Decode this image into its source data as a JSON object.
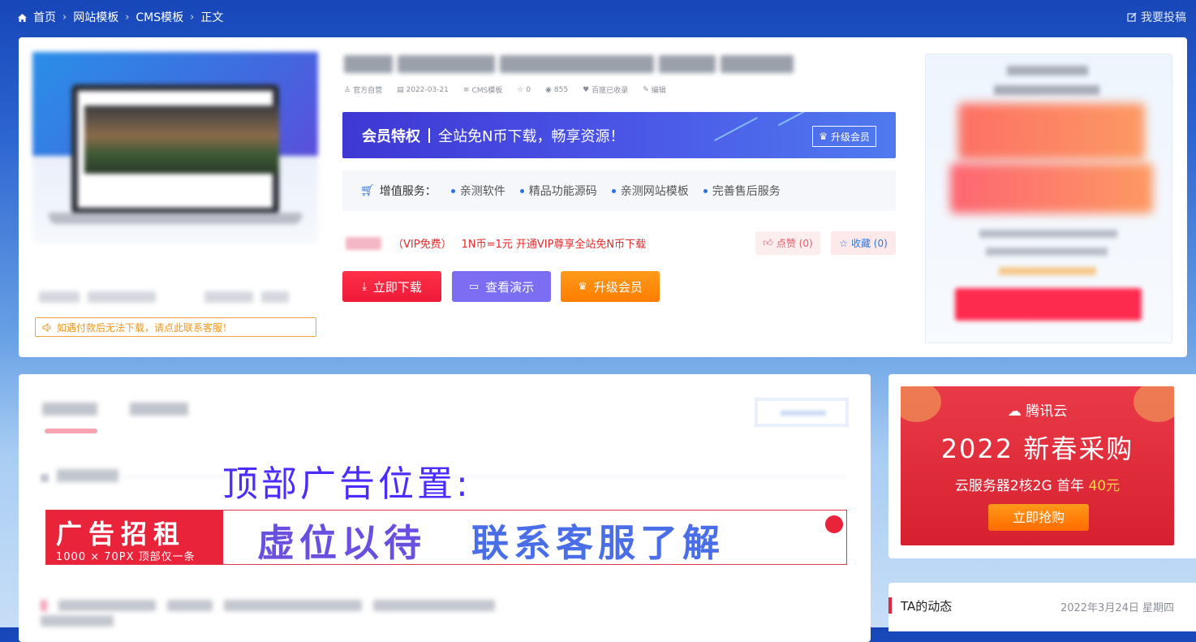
{
  "breadcrumb": {
    "items": [
      "首页",
      "网站模板",
      "CMS模板",
      "正文"
    ],
    "submit": "我要投稿"
  },
  "post": {
    "meta": {
      "author": "官方自营",
      "date": "2022-03-21",
      "category": "CMS模板",
      "stars": "0",
      "views": "855",
      "indexed": "百度已收录",
      "edit": "编辑"
    },
    "notice": "如遇付款后无法下载，请点此联系客服！"
  },
  "vip_banner": {
    "title": "会员特权",
    "text": "全站免N币下载，畅享资源！",
    "upgrade": "升级会员"
  },
  "services": {
    "label": "增值服务：",
    "items": [
      "亲测软件",
      "精品功能源码",
      "亲测网站模板",
      "完善售后服务"
    ]
  },
  "price": {
    "vip": "（VIP免费）",
    "info": "1N币=1元 开通VIP尊享全站免N币下载"
  },
  "actions": {
    "like": "点赞 (0)",
    "favorite": "收藏 (0)",
    "download": "立即下载",
    "demo": "查看演示",
    "upgrade": "升级会员"
  },
  "ad_slot": {
    "label": "顶部广告位置:",
    "banner_title": "广告招租",
    "banner_sub": "1000 × 70PX 顶部仅一条",
    "slogan1": "虚位以待",
    "slogan2": "联系客服了解"
  },
  "tencent_ad": {
    "brand": "腾讯云",
    "headline": "2022 新春采购",
    "sub": "云服务器2核2G  首年",
    "price": "40元",
    "cta": "立即抢购"
  },
  "activity": {
    "title": "TA的动态",
    "date": "2022年3月24日 星期四"
  },
  "colors": {
    "accent_red": "#ee1a38",
    "demo_purple": "#7b6ef2",
    "vip_orange": "#ff7d00",
    "ad_text": "#4b2cff"
  }
}
